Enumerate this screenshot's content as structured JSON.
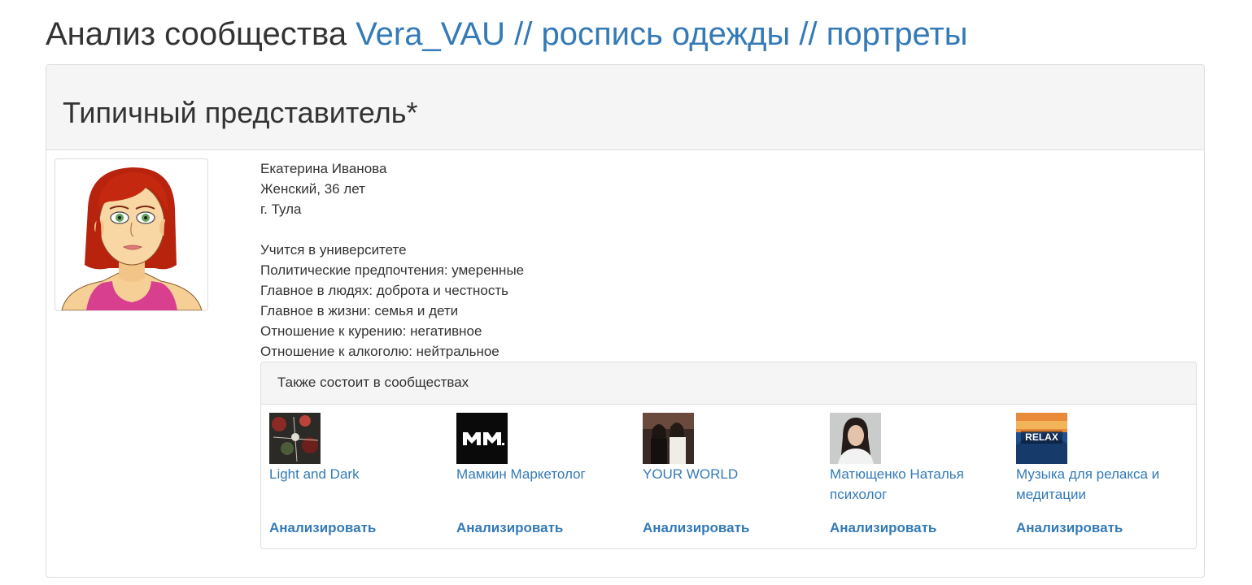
{
  "page": {
    "title_prefix": "Анализ сообщества",
    "community_name": "Vera_VAU // роспись одежды // портреты"
  },
  "panel": {
    "heading": "Типичный представитель*"
  },
  "person": {
    "name": "Екатерина Иванова",
    "gender_age": "Женский, 36 лет",
    "city": "г. Тула",
    "education": "Учится в университете",
    "politics": "Политические предпочтения: умеренные",
    "people_main": "Главное в людях: доброта и честность",
    "life_main": "Главное в жизни: семья и дети",
    "smoking": "Отношение к курению: негативное",
    "alcohol": "Отношение к алкоголю: нейтральное"
  },
  "also_member": {
    "heading": "Также состоит в сообществах",
    "analyze_label": "Анализировать",
    "groups": [
      {
        "name": "Light and Dark",
        "thumb": "dark-floral-thumbnail"
      },
      {
        "name": "Мамкин Маркетолог",
        "thumb": "mm-logo-thumbnail",
        "logo_text": "MM."
      },
      {
        "name": "YOUR WORLD",
        "thumb": "women-photo-thumbnail"
      },
      {
        "name": "Матющенко Наталья психолог",
        "thumb": "woman-portrait-thumbnail"
      },
      {
        "name": "Музыка для релакса и медитации",
        "thumb": "relax-landscape-thumbnail",
        "logo_text": "RELAX"
      }
    ]
  },
  "colors": {
    "link": "#337ab7",
    "text": "#333333",
    "panel_heading_bg": "#f5f5f5",
    "border": "#dddddd"
  }
}
